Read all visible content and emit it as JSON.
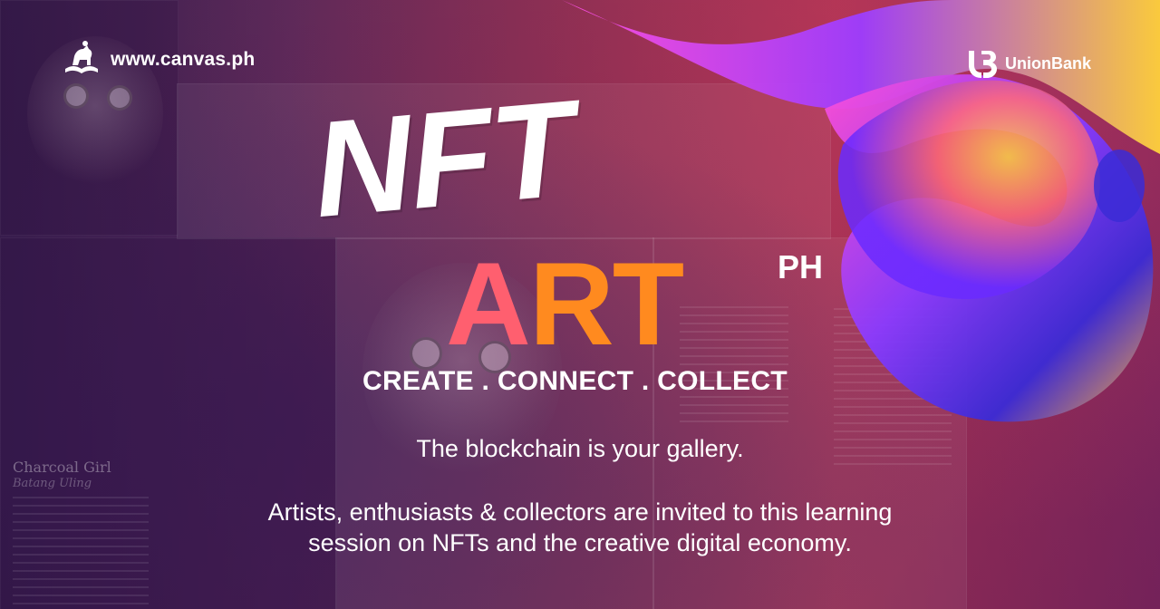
{
  "brand": {
    "site": "www.canvas.ph",
    "partner": "UnionBank",
    "partner_mark": "UB"
  },
  "headline": {
    "nft": "NFT",
    "art_a": "A",
    "art_rt": "RT",
    "ph": "PH"
  },
  "tagline": "CREATE . CONNECT . COLLECT",
  "subheadline": "The blockchain is your gallery.",
  "description": {
    "line1": "Artists, enthusiasts & collectors are invited to this learning",
    "line2": "session on NFTs and the creative digital economy."
  },
  "background": {
    "book_title": "Charcoal Girl",
    "book_subtitle": "Batang Uling"
  },
  "colors": {
    "art_pink": "#ff5f6f",
    "art_orange": "#ff8a1f",
    "text": "#ffffff"
  },
  "icons": [
    "canvas-horse-logo-icon",
    "unionbank-logo-icon"
  ]
}
